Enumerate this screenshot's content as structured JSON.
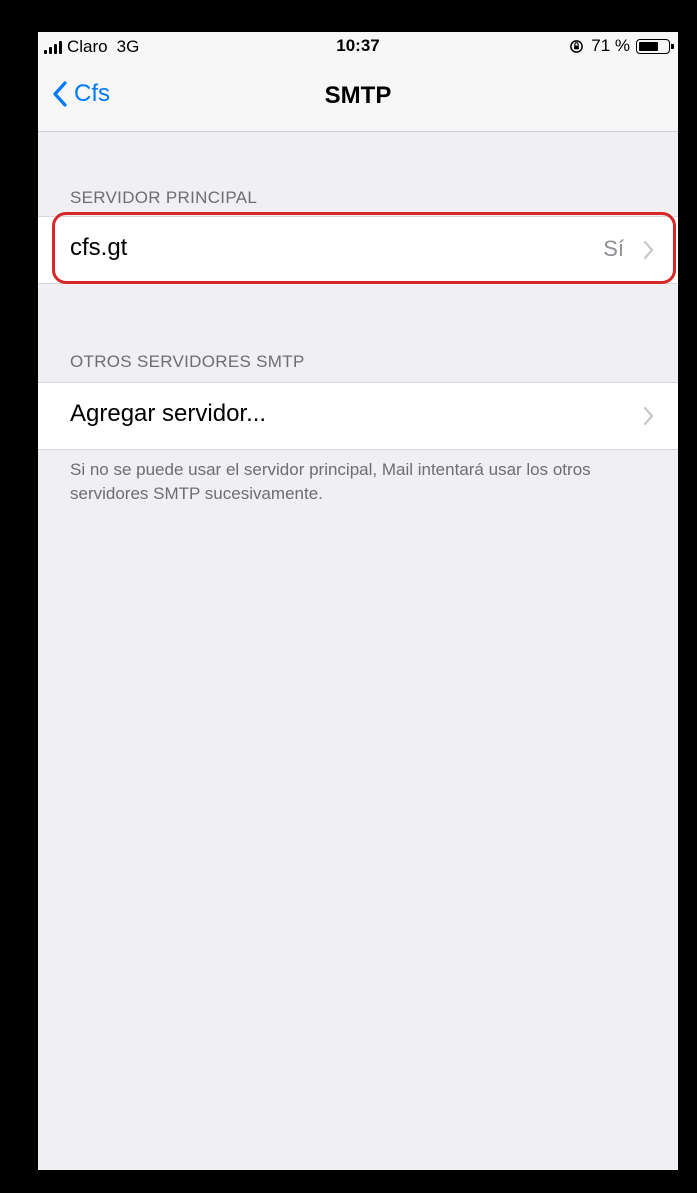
{
  "status_bar": {
    "carrier": "Claro",
    "network": "3G",
    "time": "10:37",
    "battery_percent": "71 %",
    "battery_level": 0.71
  },
  "nav": {
    "back_label": "Cfs",
    "title": "SMTP"
  },
  "primary_section": {
    "header": "SERVIDOR PRINCIPAL",
    "server_name": "cfs.gt",
    "server_status": "Sí"
  },
  "other_section": {
    "header": "OTROS SERVIDORES SMTP",
    "add_server_label": "Agregar servidor...",
    "footer": "Si no se puede usar el servidor principal, Mail intentará usar los otros servidores SMTP sucesivamente."
  },
  "colors": {
    "accent": "#007aff",
    "highlight": "#d62828",
    "background": "#efeff4"
  }
}
